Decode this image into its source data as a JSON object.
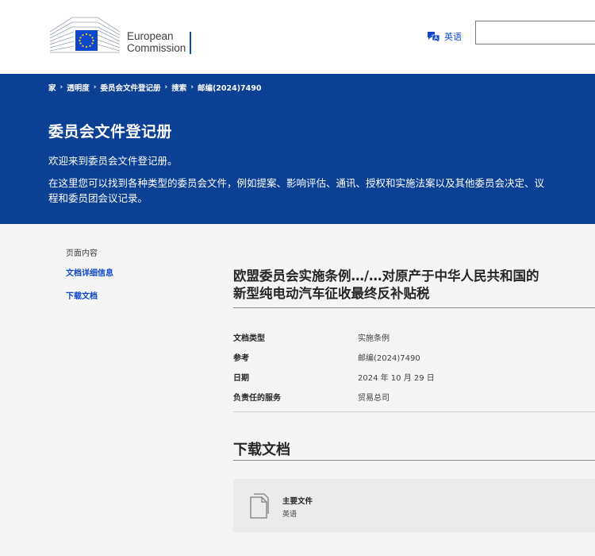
{
  "header": {
    "logo_line1": "European",
    "logo_line2": "Commission",
    "language_label": "英语",
    "search_placeholder": ""
  },
  "breadcrumb": [
    {
      "label": "家"
    },
    {
      "label": "透明度"
    },
    {
      "label": "委员会文件登记册"
    },
    {
      "label": "搜索"
    },
    {
      "label": "邮编(2024)7490"
    }
  ],
  "hero": {
    "title": "委员会文件登记册",
    "welcome": "欢迎来到委员会文件登记册。",
    "description": "在这里您可以找到各种类型的委员会文件，例如提案、影响评估、通讯、授权和实施法案以及其他委员会决定、议程和委员团会议记录。"
  },
  "toc": {
    "heading": "页面内容",
    "items": [
      {
        "label": "文档详细信息"
      },
      {
        "label": "下载文档"
      }
    ]
  },
  "document": {
    "title_line1": "欧盟委员会实施条例…/…对原产于中华人民共和国的",
    "title_line2": "新型纯电动汽车征收最终反补贴税",
    "details": [
      {
        "label": "文档类型",
        "value": "实施条例"
      },
      {
        "label": "参考",
        "value": "邮编(2024)7490"
      },
      {
        "label": "日期",
        "value": "2024 年 10 月 29 日"
      },
      {
        "label": "负责任的服务",
        "value": "贸易总司"
      }
    ]
  },
  "downloads": {
    "heading": "下载文档",
    "files": [
      {
        "name": "主要文件",
        "language": "英语"
      }
    ]
  },
  "colors": {
    "brand_blue": "#0b4095",
    "link_blue": "#0e47cb",
    "flag_yellow": "#ffd617"
  }
}
